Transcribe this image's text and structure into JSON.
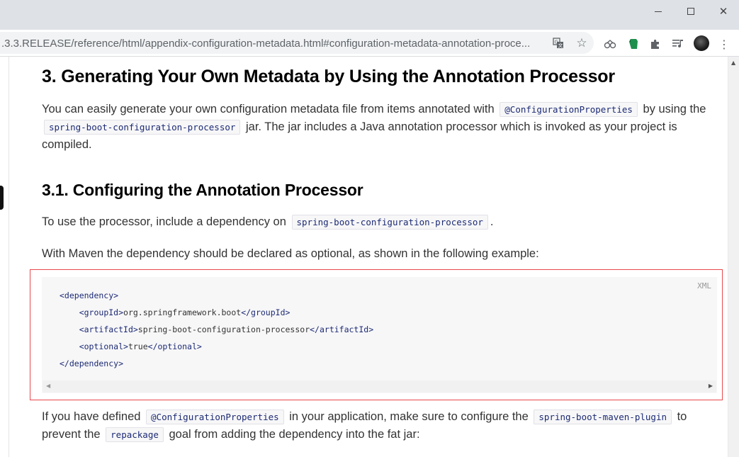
{
  "browser": {
    "url": ".3.3.RELEASE/reference/html/appendix-configuration-metadata.html#configuration-metadata-annotation-proce...",
    "icons": [
      "translate-icon",
      "star-icon",
      "extension-icon",
      "puzzle-icon",
      "media-control-icon",
      "avatar",
      "menu-icon"
    ]
  },
  "page": {
    "section_title": "3. Generating Your Own Metadata by Using the Annotation Processor",
    "p1": {
      "t1": "You can easily generate your own configuration metadata file from items annotated with",
      "c1": "@ConfigurationProperties",
      "t2": "by using the",
      "c2": "spring-boot-configuration-processor",
      "t3": "jar. The jar includes a Java annotation processor which is invoked as your project is compiled."
    },
    "subsection_title": "3.1. Configuring the Annotation Processor",
    "p2": {
      "t1": "To use the processor, include a dependency on",
      "c1": "spring-boot-configuration-processor",
      "t2": "."
    },
    "p3": "With Maven the dependency should be declared as optional, as shown in the following example:",
    "code": {
      "lang": "XML",
      "line1_open": "<dependency>",
      "line2_open": "<groupId>",
      "line2_val": "org.springframework.boot",
      "line2_close": "</groupId>",
      "line3_open": "<artifactId>",
      "line3_val": "spring-boot-configuration-processor",
      "line3_close": "</artifactId>",
      "line4_open": "<optional>",
      "line4_val": "true",
      "line4_close": "</optional>",
      "line5_close": "</dependency>"
    },
    "p4": {
      "t1": "If you have defined",
      "c1": "@ConfigurationProperties",
      "t2": "in your application, make sure to configure the",
      "c2": "spring-boot-maven-plugin",
      "t3": "to prevent the",
      "c3": "repackage",
      "t4": "goal from adding the dependency into the fat jar:"
    }
  },
  "colors": {
    "highlight_border": "#e8484d",
    "inline_code_text": "#1c2a73",
    "code_bg": "#f7f7f8"
  }
}
